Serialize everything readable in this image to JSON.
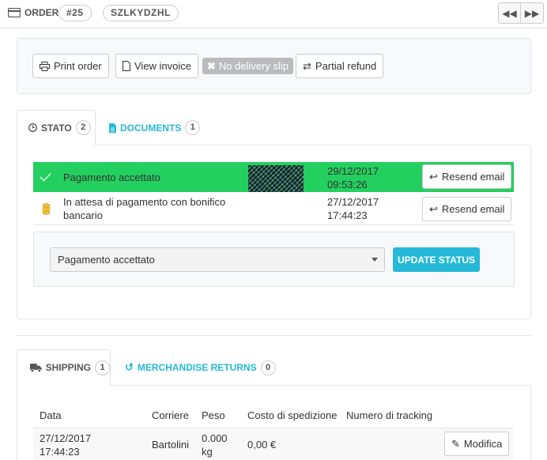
{
  "header": {
    "order_label": "ORDER",
    "order_number": "#25",
    "order_reference": "SZLKYDZHL"
  },
  "actions": {
    "print_order": "Print order",
    "view_invoice": "View invoice",
    "no_delivery_slip": "No delivery slip",
    "partial_refund": "Partial refund"
  },
  "status_tabs": {
    "stato_label": "STATO",
    "stato_count": "2",
    "documents_label": "DOCUMENTS",
    "documents_count": "1"
  },
  "status_history": [
    {
      "status": "Pagamento accettato",
      "date": "29/12/2017",
      "time": "09:53:26",
      "action": "Resend email",
      "color": "#23cf5f"
    },
    {
      "status_line1": "In attesa di pagamento con bonifico",
      "status_line2": "bancario",
      "date": "27/12/2017",
      "time": "17:44:23",
      "action": "Resend email"
    }
  ],
  "update_status": {
    "selected": "Pagamento accettato",
    "button": "UPDATE STATUS"
  },
  "shipping_tabs": {
    "shipping_label": "SHIPPING",
    "shipping_count": "1",
    "returns_label": "MERCHANDISE RETURNS",
    "returns_count": "0"
  },
  "shipping_table": {
    "columns": [
      "Data",
      "Corriere",
      "Peso",
      "Costo di spedizione",
      "Numero di tracking"
    ],
    "rows": [
      {
        "date": "27/12/2017",
        "time": "17:44:23",
        "carrier": "Bartolini",
        "weight_value": "0.000",
        "weight_unit": "kg",
        "cost": "0,00 €",
        "action": "Modifica"
      }
    ]
  },
  "colors": {
    "accent": "#25b9d7",
    "success": "#23cf5f"
  }
}
